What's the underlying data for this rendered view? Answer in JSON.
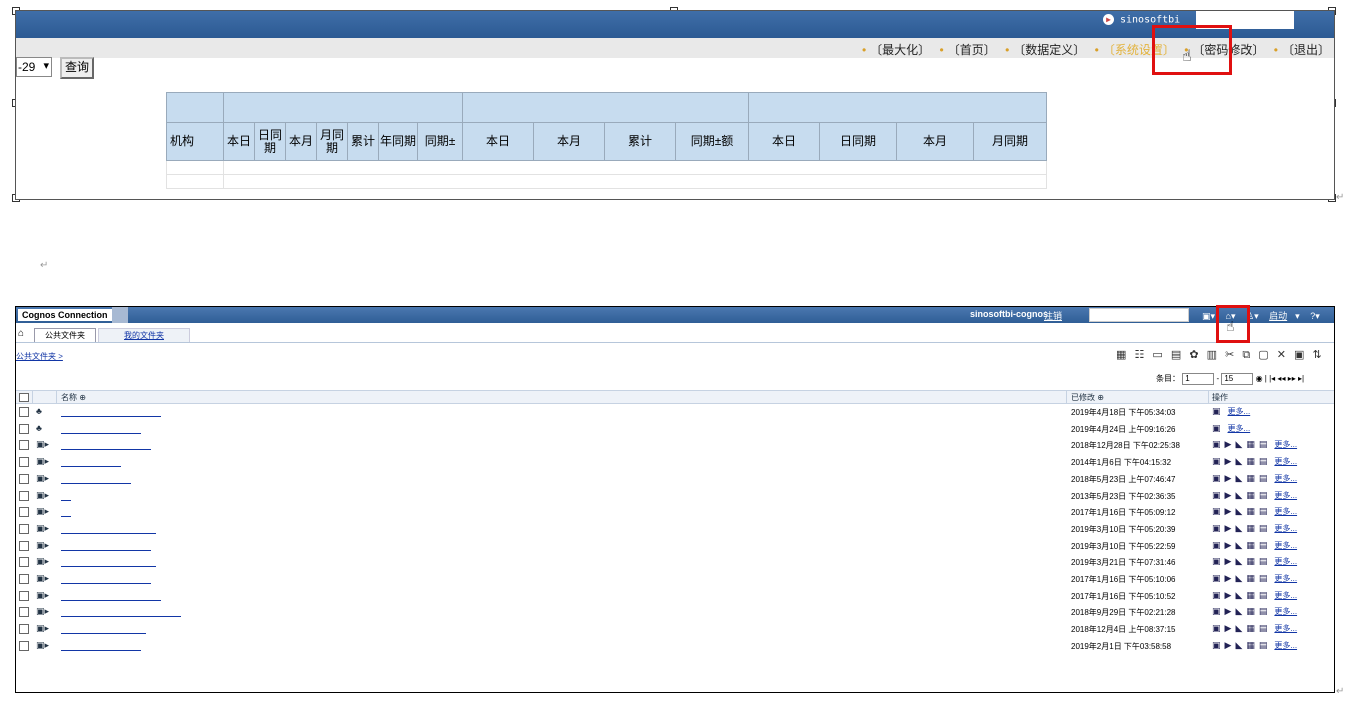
{
  "top": {
    "brand": "sinosoftbi",
    "nav_links": [
      "〔最大化〕",
      "〔首页〕",
      "〔数据定义〕",
      "〔系统设置〕",
      "〔密码修改〕",
      "〔退出〕"
    ],
    "date_value": "-29",
    "query_button": "查询",
    "table": {
      "row_header": "机构",
      "sub_headers_a": [
        "本日",
        "日同期",
        "本月",
        "月同期",
        "累计",
        "年同期",
        "同期±"
      ],
      "sub_headers_b": [
        "本日",
        "本月",
        "累计",
        "同期±额"
      ],
      "sub_headers_c": [
        "本日",
        "日同期",
        "本月",
        "月同期"
      ]
    }
  },
  "cognos": {
    "title": "Cognos Connection",
    "user": "sinosoftbi-cognos",
    "logout": "注销",
    "launch_menu": "启动",
    "tabs": [
      "公共文件夹",
      "我的文件夹"
    ],
    "breadcrumb": "公共文件夹 >",
    "pager": {
      "label": "条目：",
      "from": "1",
      "to": "15"
    },
    "columns": {
      "name": "名称",
      "modified": "已修改",
      "actions": "操作"
    },
    "more_label": "更多...",
    "rows": [
      {
        "type": "package",
        "date": "2019年4月18日 下午05:34:03"
      },
      {
        "type": "package",
        "date": "2019年4月24日 上午09:16:26"
      },
      {
        "type": "report",
        "date": "2018年12月28日 下午02:25:38"
      },
      {
        "type": "report",
        "date": "2014年1月6日 下午04:15:32"
      },
      {
        "type": "report",
        "date": "2018年5月23日 上午07:46:47"
      },
      {
        "type": "report",
        "date": "2013年5月23日 下午02:36:35"
      },
      {
        "type": "report",
        "date": "2017年1月16日 下午05:09:12"
      },
      {
        "type": "report",
        "date": "2019年3月10日 下午05:20:39"
      },
      {
        "type": "report",
        "date": "2019年3月10日 下午05:22:59"
      },
      {
        "type": "report",
        "date": "2019年3月21日 下午07:31:46"
      },
      {
        "type": "report",
        "date": "2017年1月16日 下午05:10:06"
      },
      {
        "type": "report",
        "date": "2017年1月16日 下午05:10:52"
      },
      {
        "type": "report",
        "date": "2018年9月29日 下午02:21:28"
      },
      {
        "type": "report",
        "date": "2018年12月4日 上午08:37:15"
      },
      {
        "type": "report",
        "date": "2019年2月1日 下午03:58:58"
      }
    ]
  }
}
